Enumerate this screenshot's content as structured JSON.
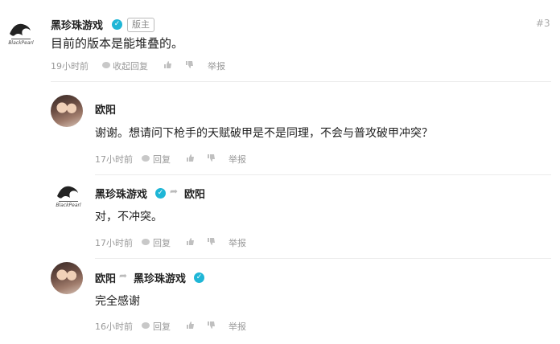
{
  "main_comment": {
    "author": "黑珍珠游戏",
    "badge": "版主",
    "floor": "#3",
    "text": "目前的版本是能堆叠的。",
    "time": "19小时前",
    "collapse_label": "收起回复",
    "report_label": "举报",
    "avatar_text": "BlackPearl"
  },
  "replies": [
    {
      "author": "欧阳",
      "text": "谢谢。想请问下枪手的天赋破甲是不是同理，不会与普攻破甲冲突？",
      "time": "17小时前",
      "reply_label": "回复",
      "report_label": "举报"
    },
    {
      "author": "黑珍珠游戏",
      "reply_to": "欧阳",
      "text": "对，不冲突。",
      "time": "17小时前",
      "reply_label": "回复",
      "report_label": "举报",
      "avatar_text": "BlackPearl"
    },
    {
      "author": "欧阳",
      "reply_to": "黑珍珠游戏",
      "text": "完全感谢",
      "time": "16小时前",
      "reply_label": "回复",
      "report_label": "举报"
    }
  ],
  "colors": {
    "verify": "#1fb6d6",
    "meta": "#999999",
    "divider": "#ececec"
  }
}
